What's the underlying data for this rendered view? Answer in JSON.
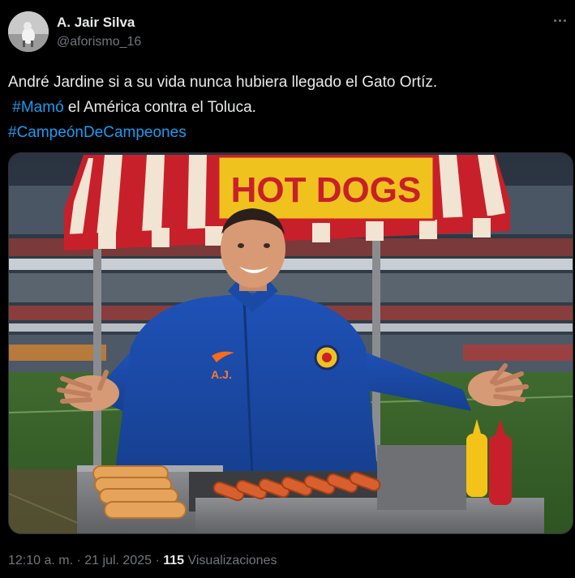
{
  "author": {
    "display_name": "A. Jair Silva",
    "handle": "@aforismo_16",
    "avatar_icon": "avatar-photo"
  },
  "tweet": {
    "line1": "André Jardine si a su vida nunca hubiera llegado el Gato Ortíz.",
    "line2_hashtag": "#Mamó",
    "line2_rest": " el América contra el Toluca.",
    "line3_hashtag": "#CampeónDeCampeones"
  },
  "image": {
    "sign_text": "HOT DOGS",
    "jacket_initials": "A.J."
  },
  "meta": {
    "time": "12:10 a. m.",
    "separator": " · ",
    "date": "21 jul. 2025",
    "separator2": " · ",
    "views_count": "115",
    "views_label": " Visualizaciones"
  },
  "colors": {
    "background": "#000000",
    "text": "#e7e9ea",
    "secondary": "#71767b",
    "link": "#1d9bf0"
  }
}
